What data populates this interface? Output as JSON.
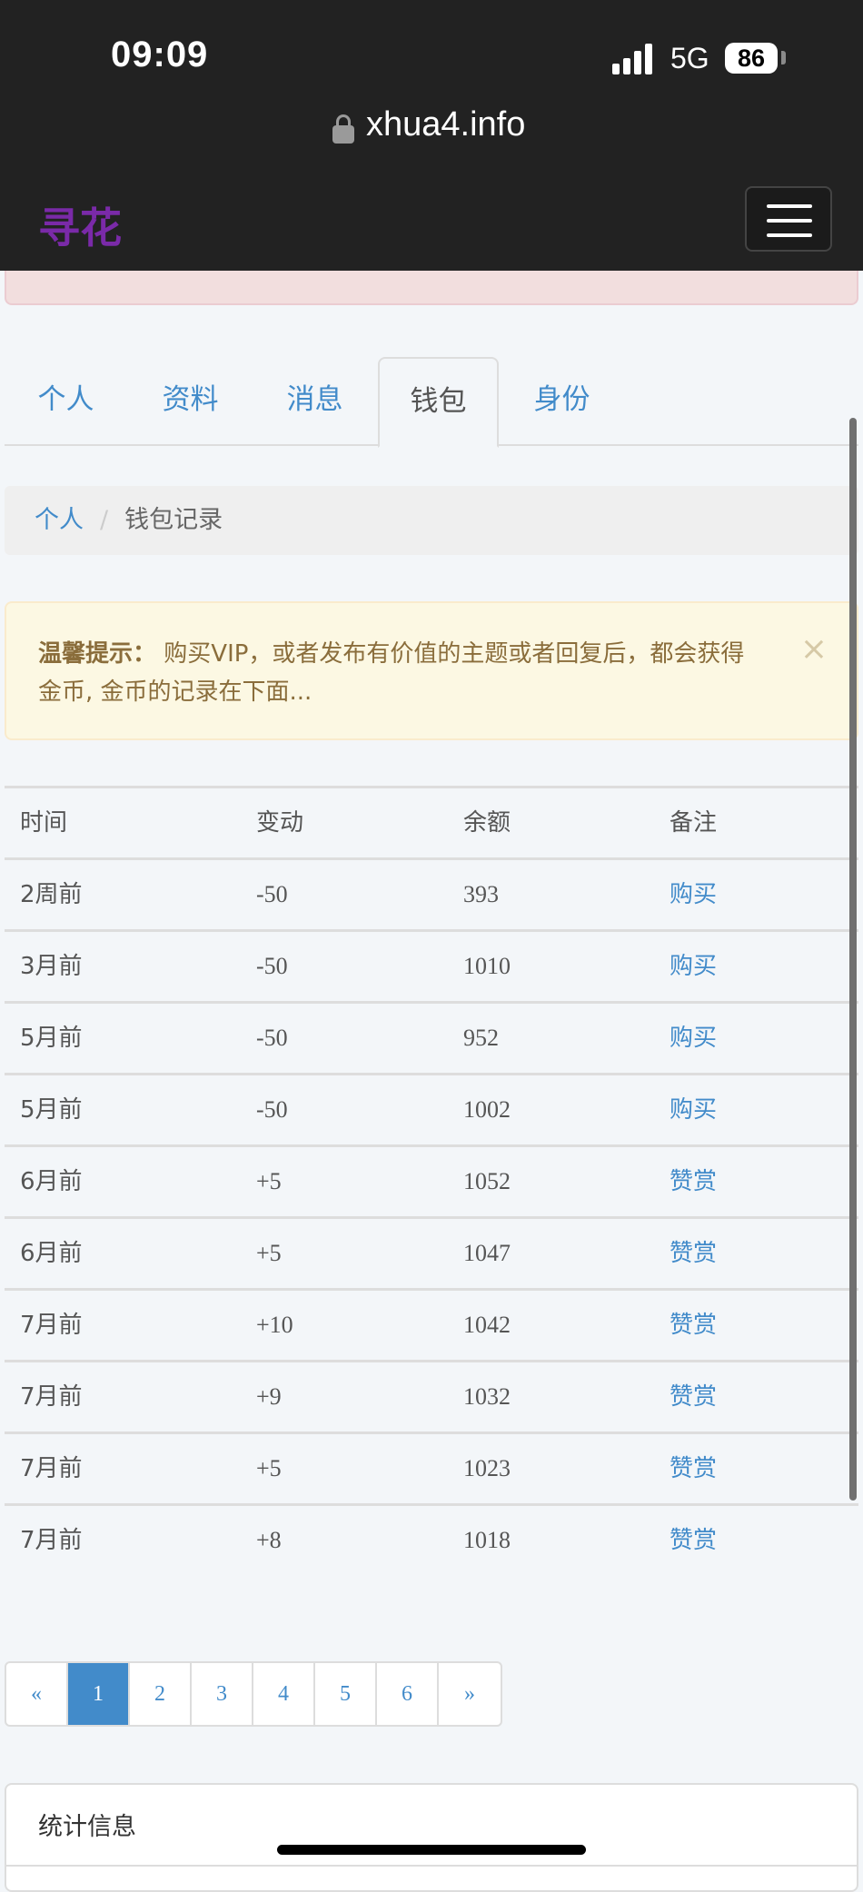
{
  "status": {
    "time": "09:09",
    "network": "5G",
    "battery": "86"
  },
  "browser": {
    "url": "xhua4.info"
  },
  "navbar": {
    "brand": "寻花"
  },
  "tabs": [
    {
      "label": "个人",
      "active": false
    },
    {
      "label": "资料",
      "active": false
    },
    {
      "label": "消息",
      "active": false
    },
    {
      "label": "钱包",
      "active": true
    },
    {
      "label": "身份",
      "active": false
    }
  ],
  "breadcrumb": {
    "home": "个人",
    "separator": "/",
    "current": "钱包记录"
  },
  "alert": {
    "title": "温馨提示：",
    "text": "购买VIP，或者发布有价值的主题或者回复后，都会获得金币, 金币的记录在下面...",
    "close": "×"
  },
  "table": {
    "headers": [
      "时间",
      "变动",
      "余额",
      "备注"
    ],
    "rows": [
      {
        "time": "2周前",
        "change": "-50",
        "balance": "393",
        "note": "购买"
      },
      {
        "time": "3月前",
        "change": "-50",
        "balance": "1010",
        "note": "购买"
      },
      {
        "time": "5月前",
        "change": "-50",
        "balance": "952",
        "note": "购买"
      },
      {
        "time": "5月前",
        "change": "-50",
        "balance": "1002",
        "note": "购买"
      },
      {
        "time": "6月前",
        "change": "+5",
        "balance": "1052",
        "note": "赞赏"
      },
      {
        "time": "6月前",
        "change": "+5",
        "balance": "1047",
        "note": "赞赏"
      },
      {
        "time": "7月前",
        "change": "+10",
        "balance": "1042",
        "note": "赞赏"
      },
      {
        "time": "7月前",
        "change": "+9",
        "balance": "1032",
        "note": "赞赏"
      },
      {
        "time": "7月前",
        "change": "+5",
        "balance": "1023",
        "note": "赞赏"
      },
      {
        "time": "7月前",
        "change": "+8",
        "balance": "1018",
        "note": "赞赏"
      }
    ]
  },
  "pagination": {
    "prev": "«",
    "pages": [
      "1",
      "2",
      "3",
      "4",
      "5",
      "6"
    ],
    "active": "1",
    "next": "»"
  },
  "panel": {
    "title": "统计信息"
  },
  "colors": {
    "link": "#428bca",
    "brand": "#7a2aa8",
    "navbar": "#222222"
  }
}
